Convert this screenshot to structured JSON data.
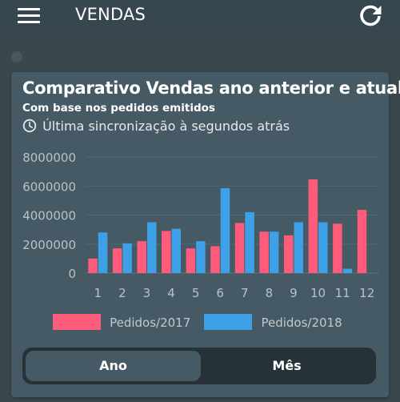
{
  "app_bar": {
    "title": "VENDAS",
    "menu_icon": "hamburger-menu-icon",
    "refresh_icon": "refresh-icon"
  },
  "card": {
    "title": "Comparativo Vendas ano anterior e atual",
    "subtitle": "Com base nos pedidos emitidos",
    "sync_text": "Última sincronização à segundos atrás",
    "sync_icon": "clock-icon"
  },
  "toggle": {
    "year_label": "Ano",
    "month_label": "Mês",
    "selected": "Ano"
  },
  "colors": {
    "series_2017": "#ff5c7c",
    "series_2018": "#3ea1e8",
    "background": "#37474f",
    "card": "#455a64"
  },
  "chart_data": {
    "type": "bar",
    "categories": [
      "1",
      "2",
      "3",
      "4",
      "5",
      "6",
      "7",
      "8",
      "9",
      "10",
      "11",
      "12"
    ],
    "y_ticks": [
      "0",
      "2000000",
      "4000000",
      "6000000",
      "8000000"
    ],
    "ylim": [
      0,
      8000000
    ],
    "grid": true,
    "legend_position": "bottom",
    "series": [
      {
        "name": "Pedidos/2017",
        "color": "#ff5c7c",
        "values": [
          1000000,
          1700000,
          2200000,
          2900000,
          1700000,
          1850000,
          3450000,
          2850000,
          2600000,
          6450000,
          3400000,
          4350000
        ]
      },
      {
        "name": "Pedidos/2018",
        "color": "#3ea1e8",
        "values": [
          2800000,
          2050000,
          3500000,
          3050000,
          2200000,
          5850000,
          4200000,
          2850000,
          3500000,
          3500000,
          300000,
          0
        ]
      }
    ]
  }
}
